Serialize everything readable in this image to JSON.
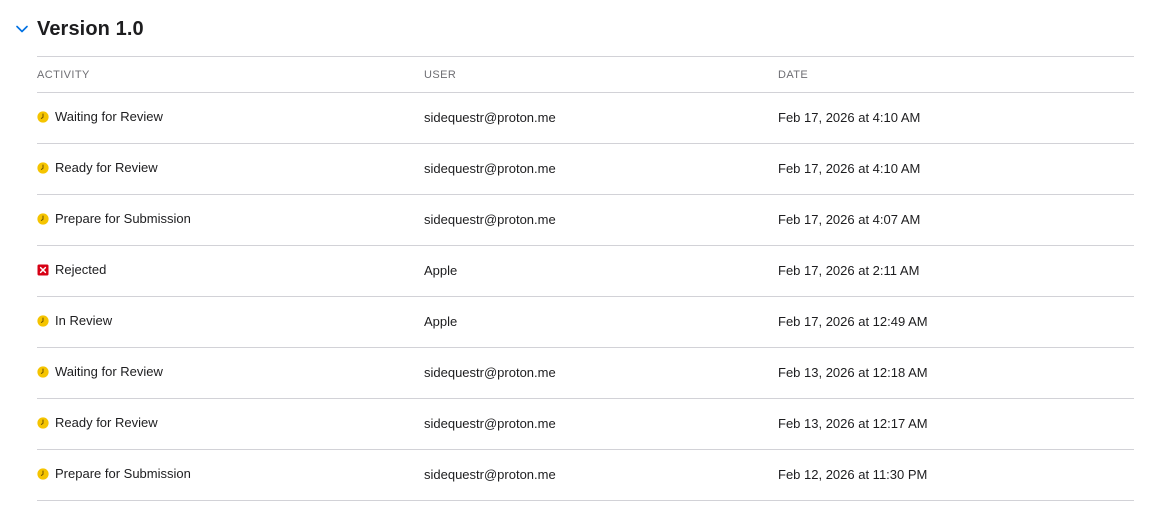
{
  "section": {
    "title": "Version 1.0",
    "expanded": true
  },
  "columns": {
    "activity": "ACTIVITY",
    "user": "USER",
    "date": "DATE"
  },
  "colors": {
    "pending": "#f5c400",
    "rejected": "#d70015",
    "accent": "#0071e3"
  },
  "rows": [
    {
      "status": "pending",
      "icon": "clock-icon",
      "activity": "Waiting for Review",
      "user": "sidequestr@proton.me",
      "date": "Feb 17, 2026 at 4:10 AM"
    },
    {
      "status": "pending",
      "icon": "clock-icon",
      "activity": "Ready for Review",
      "user": "sidequestr@proton.me",
      "date": "Feb 17, 2026 at 4:10 AM"
    },
    {
      "status": "pending",
      "icon": "clock-icon",
      "activity": "Prepare for Submission",
      "user": "sidequestr@proton.me",
      "date": "Feb 17, 2026 at 4:07 AM"
    },
    {
      "status": "rejected",
      "icon": "rejected-x-icon",
      "activity": "Rejected",
      "user": "Apple",
      "date": "Feb 17, 2026 at 2:11 AM"
    },
    {
      "status": "pending",
      "icon": "clock-icon",
      "activity": "In Review",
      "user": "Apple",
      "date": "Feb 17, 2026 at 12:49 AM"
    },
    {
      "status": "pending",
      "icon": "clock-icon",
      "activity": "Waiting for Review",
      "user": "sidequestr@proton.me",
      "date": "Feb 13, 2026 at 12:18 AM"
    },
    {
      "status": "pending",
      "icon": "clock-icon",
      "activity": "Ready for Review",
      "user": "sidequestr@proton.me",
      "date": "Feb 13, 2026 at 12:17 AM"
    },
    {
      "status": "pending",
      "icon": "clock-icon",
      "activity": "Prepare for Submission",
      "user": "sidequestr@proton.me",
      "date": "Feb 12, 2026 at 11:30 PM"
    }
  ]
}
